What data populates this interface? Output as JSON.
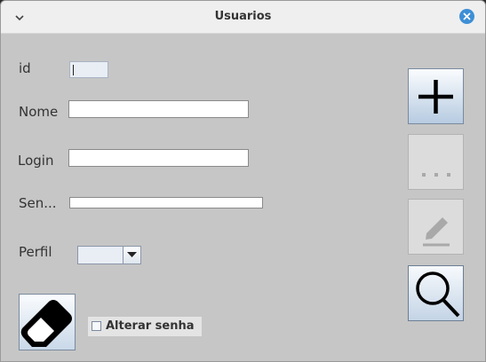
{
  "window": {
    "title": "Usuarios",
    "icons": {
      "menu": "chevron-down-icon",
      "close": "close-icon"
    },
    "accent_color": "#3d8fd6"
  },
  "form": {
    "id_label": "id",
    "id_value": "",
    "nome_label": "Nome",
    "nome_value": "",
    "login_label": "Login",
    "login_value": "",
    "senha_label": "Sen...",
    "senha_value": "",
    "perfil_label": "Perfil",
    "perfil_selected": ""
  },
  "actions": {
    "add": "plus-icon",
    "more": "ellipsis-icon",
    "edit": "pencil-icon",
    "search": "magnifier-icon",
    "clear": "eraser-icon"
  },
  "options": {
    "alterar_senha_label": "Alterar senha",
    "alterar_senha_checked": false
  }
}
